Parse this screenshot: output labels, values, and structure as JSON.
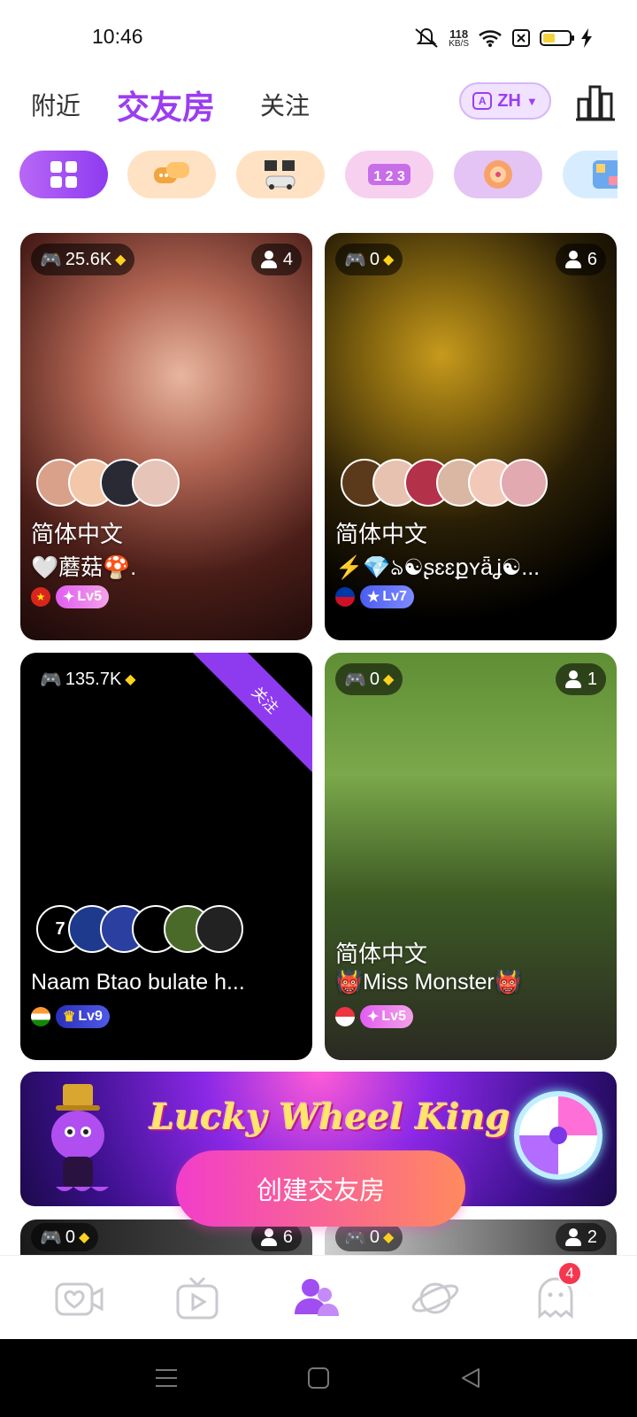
{
  "status": {
    "time": "10:46",
    "speed_value": "118",
    "speed_unit": "KB/S"
  },
  "tabs": {
    "nearby": "附近",
    "rooms": "交友房",
    "follow": "关注"
  },
  "lang": {
    "label": "ZH",
    "icon_letter": "A"
  },
  "chips": [
    {
      "icon": "grid-icon",
      "active": true
    },
    {
      "icon": "chat-bubbles-icon"
    },
    {
      "icon": "race-flags-icon"
    },
    {
      "icon": "number-tiles-icon"
    },
    {
      "icon": "wheel-icon"
    },
    {
      "icon": "board-game-icon"
    }
  ],
  "cards": [
    {
      "stat": "25.6K",
      "users": "4",
      "title": "简体中文",
      "subtitle": "🤍蘑菇🍄.",
      "flag_icon": "vietnam-flag-icon",
      "level": "Lv5",
      "avatar_colors": [
        "#d9a08a",
        "#f3c7a9",
        "#2a2a35",
        "#e6c4b8"
      ]
    },
    {
      "stat": "0",
      "users": "6",
      "title": "简体中文",
      "subtitle": "⚡💎ঌ☯ʂɛɛքʏǟʝ☯...",
      "flag_icon": "philippines-flag-icon",
      "level": "Lv7",
      "avatar_colors": [
        "#5a3a1a",
        "#e8c2b0",
        "#b4314a",
        "#d9b7a2",
        "#f2c9b8",
        "#e2a9b0"
      ]
    },
    {
      "stat": "135.7K",
      "ribbon": "关注",
      "avatar_count": "7",
      "subtitle": "Naam Btao bulate h...",
      "flag_icon": "india-flag-icon",
      "level": "Lv9",
      "avatar_colors": [
        "#1d3a8c",
        "#2b3fa0",
        "#000000",
        "#4a6a2a",
        "#222222"
      ]
    },
    {
      "stat": "0",
      "users": "1",
      "title": "简体中文",
      "subtitle": "👹Miss Monster👹",
      "flag_icon": "singapore-flag-icon",
      "level": "Lv5"
    },
    {
      "stat": "0",
      "users": "6"
    },
    {
      "stat": "0",
      "users": "2"
    }
  ],
  "banner": {
    "title": "Lucky Wheel King"
  },
  "create_button": "创建交友房",
  "bottom_nav": {
    "message_badge": "4"
  },
  "colors": {
    "accent": "#9b3df0",
    "badge": "#f5364f"
  }
}
